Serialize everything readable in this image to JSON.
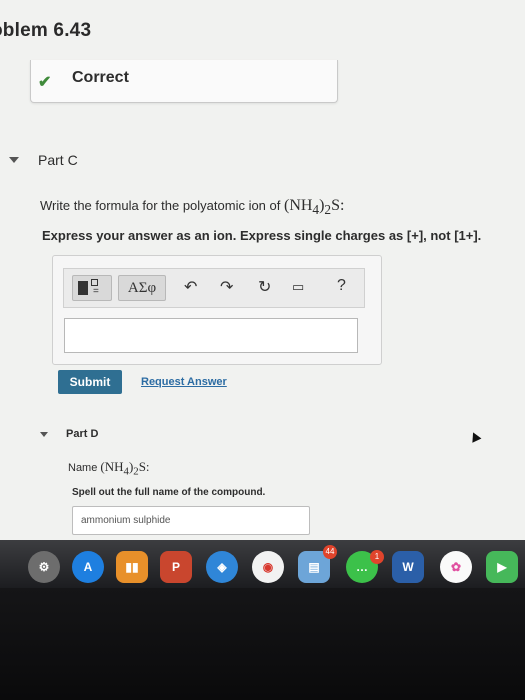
{
  "problem": {
    "title": "oblem 6.43"
  },
  "feedback": {
    "status": "Correct"
  },
  "part_c": {
    "label": "Part C",
    "question_prefix": "Write the formula for the polyatomic ion of ",
    "formula": "(NH",
    "sub4": "4",
    "close": ")",
    "sub2": "2",
    "suffix": "S:",
    "instructions": "Express your answer as an ion. Express single charges as [+], not [1+].",
    "toolbar": {
      "greek": "ΑΣφ",
      "undo": "↶",
      "redo": "↷",
      "reset": "↻",
      "keyboard": "▭",
      "help": "?"
    },
    "answer_value": "",
    "submit_label": "Submit",
    "request_label": "Request Answer"
  },
  "part_d": {
    "label": "Part D",
    "name_prefix": "Name ",
    "formula": "(NH",
    "sub4": "4",
    "close": ")",
    "sub2": "2",
    "suffix": "S:",
    "instructions": "Spell out the full name of the compound.",
    "answer_value": "ammonium sulphide"
  },
  "dock": {
    "badges": {
      "calendar": "44",
      "messages": "1"
    },
    "powerpoint_label": "P",
    "word_label": "W"
  },
  "colors": {
    "accent": "#2f6f92",
    "link": "#2c6ca3",
    "correct": "#3f8a3a"
  }
}
